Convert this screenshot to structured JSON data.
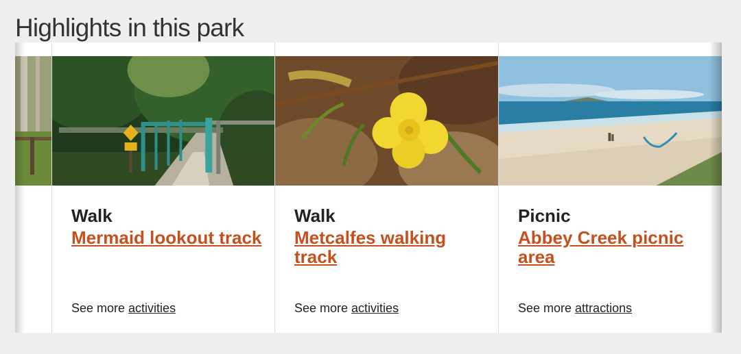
{
  "section": {
    "title": "Highlights in this park"
  },
  "cards": [
    {
      "image": "walking-track-bridge-photo",
      "type": "Walk",
      "title": "Mermaid lookout track",
      "more_prefix": "See more ",
      "more_link": "activities"
    },
    {
      "image": "yellow-flower-photo",
      "type": "Walk",
      "title": "Metcalfes walking track",
      "more_prefix": "See more ",
      "more_link": "activities"
    },
    {
      "image": "beach-picnic-area-photo",
      "type": "Picnic",
      "title": "Abbey Creek picnic area",
      "more_prefix": "See more ",
      "more_link": "attractions"
    }
  ],
  "colors": {
    "link": "#c5501e",
    "background": "#f0efed",
    "text": "#222222"
  }
}
